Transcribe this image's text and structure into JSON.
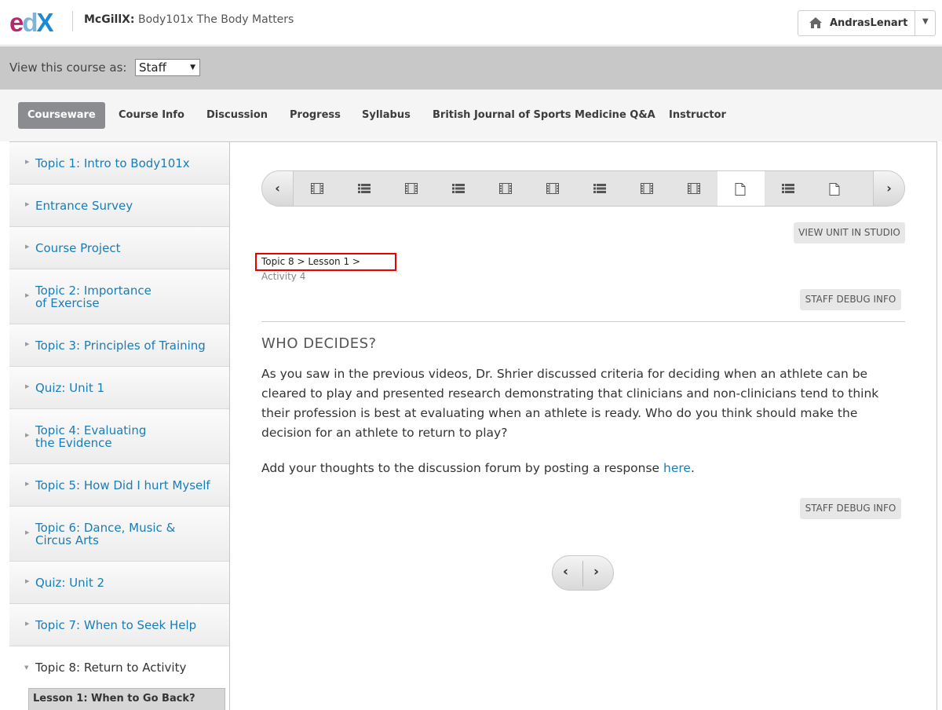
{
  "header": {
    "logo": {
      "e": "e",
      "d": "d",
      "x": "X"
    },
    "course_org": "McGillX:",
    "course_name": " Body101x The Body Matters",
    "username": "AndrasLenart"
  },
  "staff_bar": {
    "label": "View this course as:",
    "selected": "Staff"
  },
  "nav": {
    "tabs": [
      "Courseware",
      "Course Info",
      "Discussion",
      "Progress",
      "Syllabus",
      "British Journal of Sports Medicine Q&A",
      "Instructor"
    ]
  },
  "sidebar": {
    "items": [
      {
        "label": "Topic 1: Intro to Body101x"
      },
      {
        "label": "Entrance Survey"
      },
      {
        "label": "Course Project"
      },
      {
        "label": "Topic 2: Importance",
        "label2": "of Exercise"
      },
      {
        "label": "Topic 3: Principles of Training"
      },
      {
        "label": "Quiz: Unit 1"
      },
      {
        "label": "Topic 4: Evaluating",
        "label2": "the Evidence"
      },
      {
        "label": "Topic 5: How Did I hurt Myself"
      },
      {
        "label": "Topic 6: Dance, Music &",
        "label2": "Circus Arts"
      },
      {
        "label": "Quiz: Unit 2"
      },
      {
        "label": "Topic 7: When to Seek Help"
      },
      {
        "label": "Topic 8: Return to Activity"
      }
    ],
    "lesson": "Lesson 1: When to Go Back?"
  },
  "sequence": {
    "icons": [
      "video",
      "list",
      "video",
      "list",
      "video",
      "video",
      "list",
      "video",
      "video",
      "doc",
      "list",
      "doc"
    ],
    "active_index": 9
  },
  "buttons": {
    "view_studio": "VIEW UNIT IN STUDIO",
    "staff_debug": "STAFF DEBUG INFO"
  },
  "breadcrumb": {
    "topic": "Topic 8",
    "sep": " > ",
    "lesson": "Lesson 1",
    "activity": "Activity 4"
  },
  "content": {
    "heading": "WHO DECIDES?",
    "paragraph": "As you saw in the previous videos, Dr. Shrier discussed criteria for deciding when an athlete can be cleared to play and presented research demonstrating that clinicians and non-clinicians tend to think their profession is best at evaluating when an athlete is ready. Who do you think should make the decision for an athlete to return to play?",
    "para2_before": "Add your thoughts to the discussion forum by posting a response ",
    "para2_link": "here",
    "para2_after": "."
  }
}
